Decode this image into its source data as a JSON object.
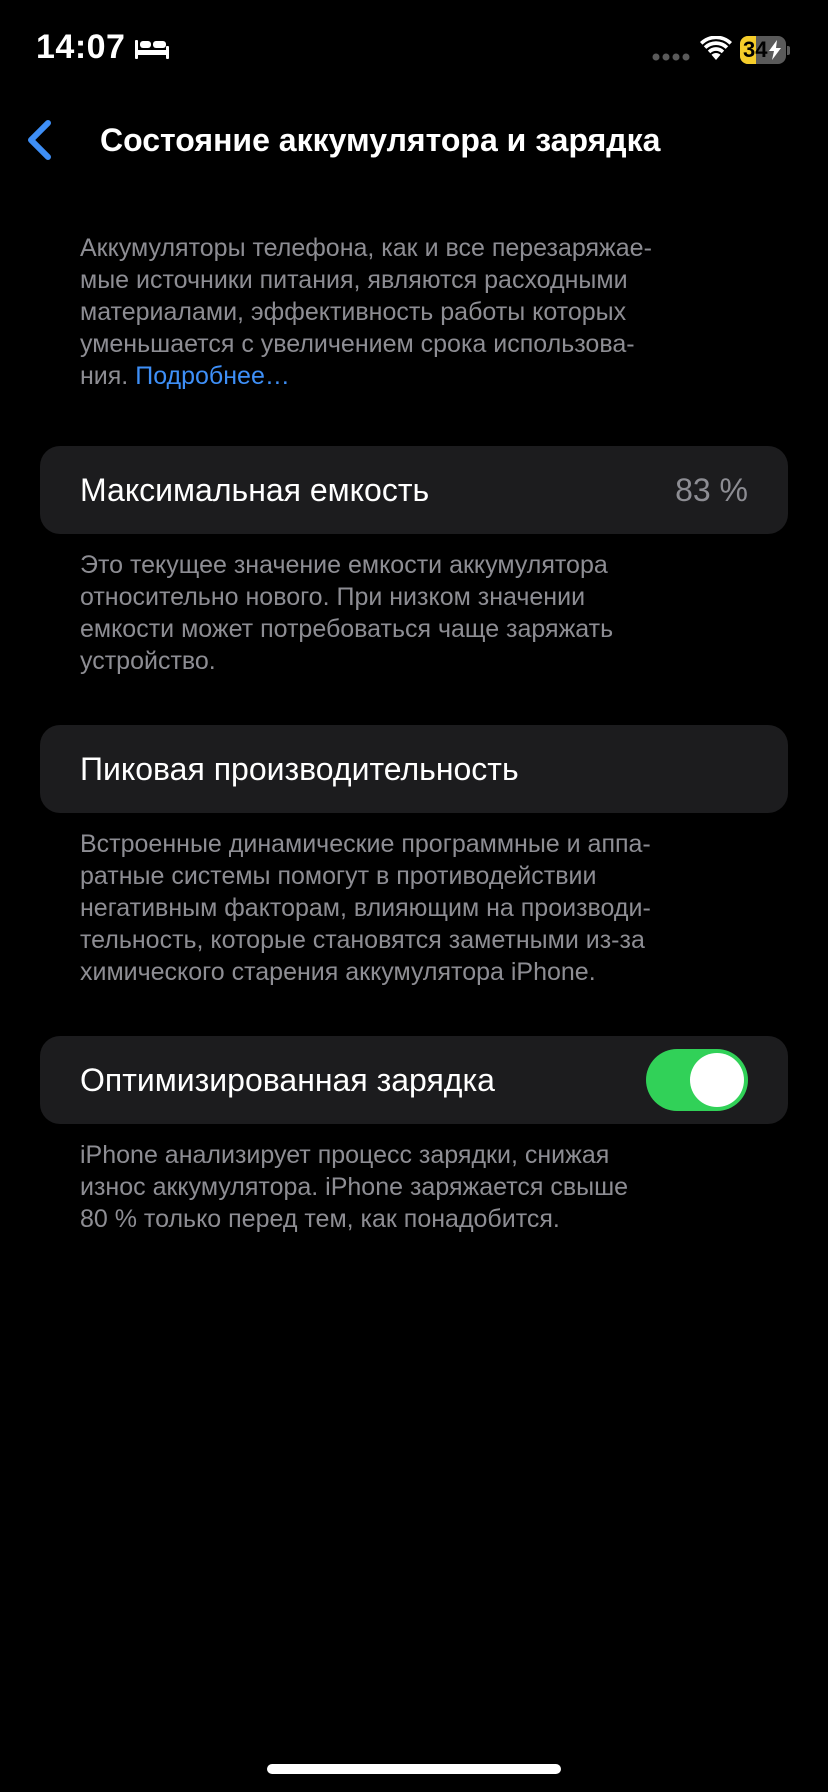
{
  "status_bar": {
    "time": "14:07",
    "battery_level": "34",
    "battery_fraction": 0.34,
    "icons": [
      "sleep-focus-icon",
      "cellular-signal-icon",
      "wifi-icon",
      "battery-icon",
      "charging-bolt-icon"
    ]
  },
  "nav": {
    "back_icon": "chevron-left-icon",
    "title": "Состояние аккумулятора и зарядка"
  },
  "intro": {
    "lines": [
      "Аккумуляторы телефона, как и все перезаряжае-",
      "мые источники питания, являются расходными",
      "материалами, эффективность работы которых",
      "уменьшается с увеличением срока использова-",
      "ния."
    ],
    "link": "Подробнее…"
  },
  "max_capacity": {
    "label": "Максимальная емкость",
    "value": "83 %",
    "footer_lines": [
      "Это текущее значение емкости аккумулятора",
      "относительно нового. При низком значении",
      "емкости может потребоваться чаще заряжать",
      "устройство."
    ]
  },
  "peak_performance": {
    "label": "Пиковая производительность",
    "footer_lines": [
      "Встроенные динамические программные и аппа-",
      "ратные системы помогут в противодействии",
      "негативным факторам, влияющим на производи-",
      "тельность, которые становятся заметными из-за",
      "химического старения аккумулятора iPhone."
    ]
  },
  "optimized_charging": {
    "label": "Оптимизированная зарядка",
    "enabled": true,
    "footer_lines": [
      "iPhone анализирует процесс зарядки, снижая",
      "износ аккумулятора. iPhone заряжается свыше",
      "80 % только перед тем, как понадобится."
    ]
  },
  "colors": {
    "background": "#000000",
    "cell": "#1c1c1e",
    "secondary_text": "#8d8d93",
    "link": "#3e8ff7",
    "toggle_on": "#31d158",
    "battery_fill": "#f5cd2a"
  }
}
